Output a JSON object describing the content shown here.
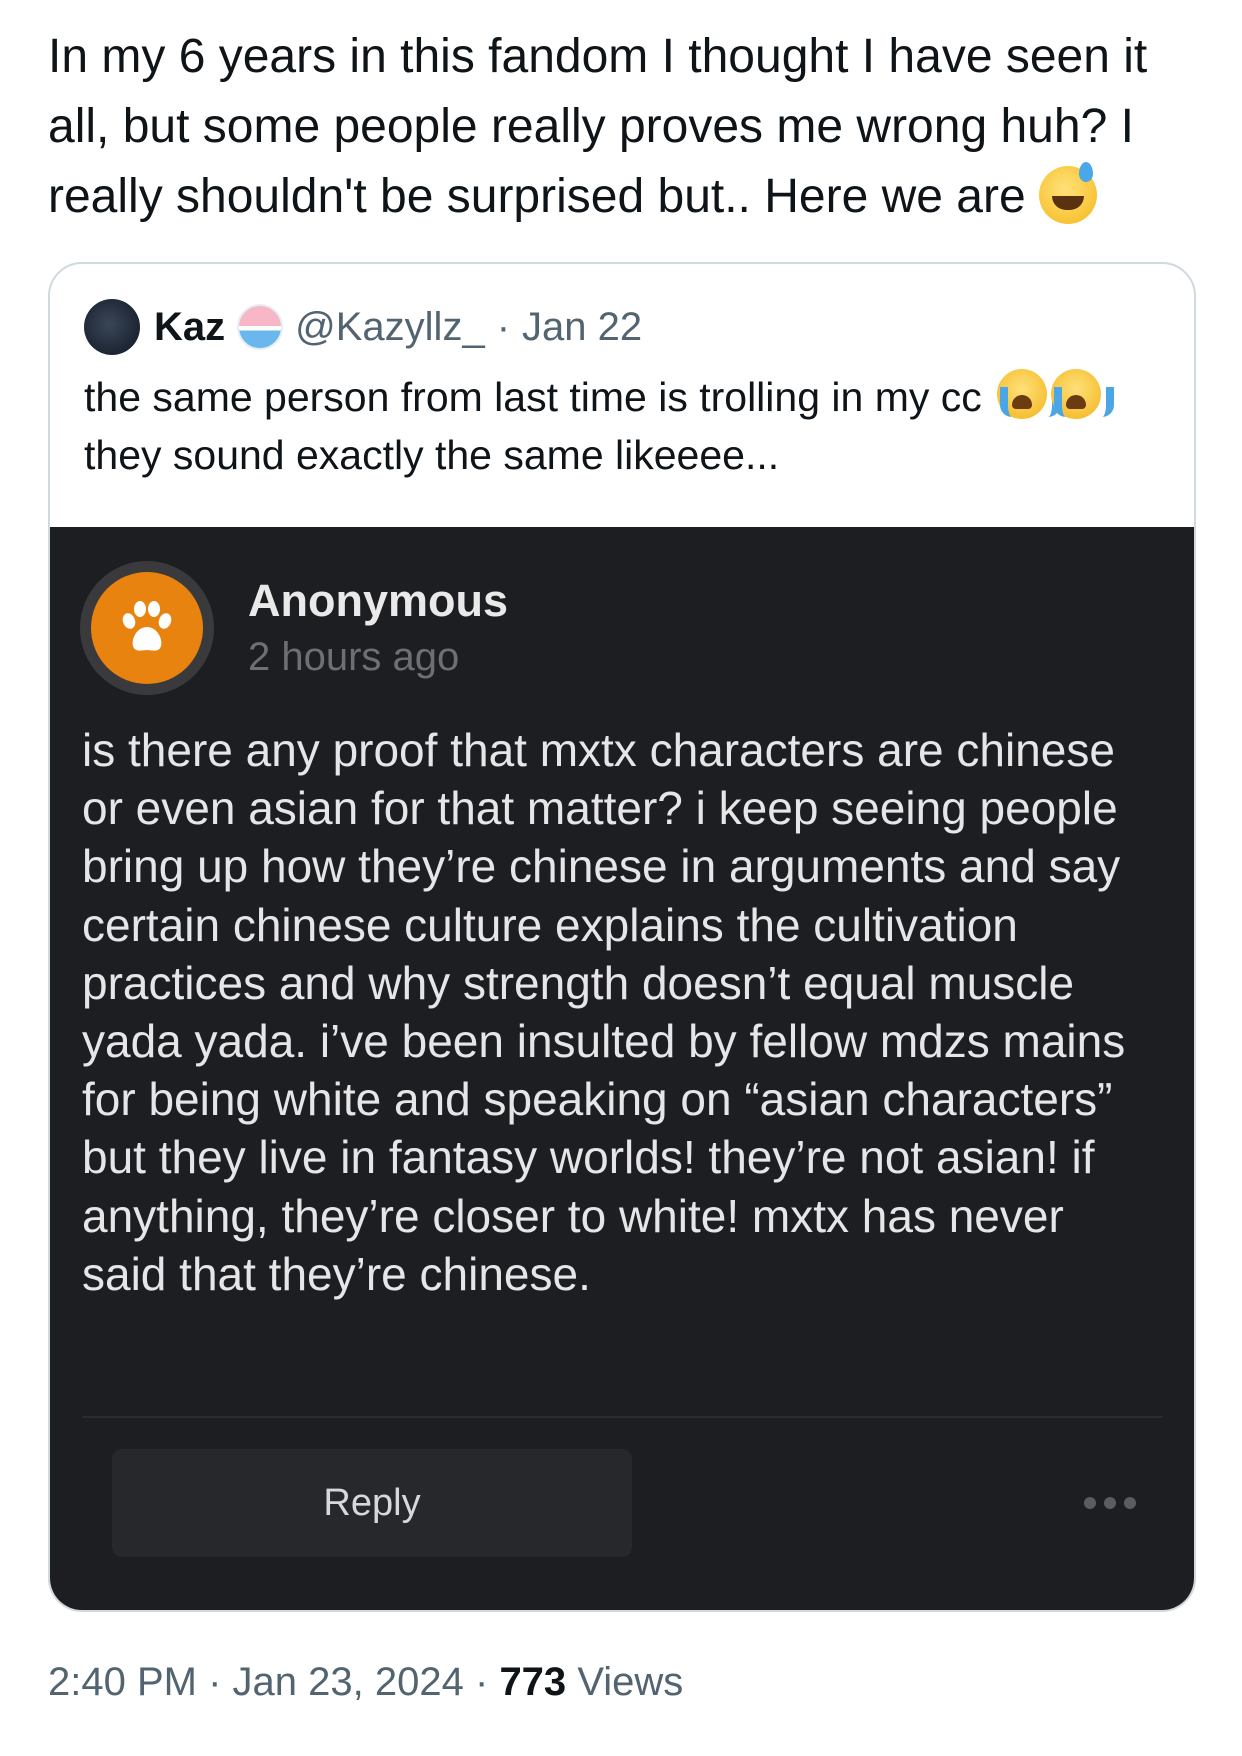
{
  "tweet": {
    "text": "In my 6 years in this fandom I thought I have seen it all, but some people really proves me wrong huh? I really shouldn't be surprised but.. Here we are",
    "emoji": "sweat-smile-emoji",
    "quoted": {
      "name": "Kaz",
      "name_emoji": "shaved-ice-emoji",
      "handle": "@Kazyllz_",
      "separator": "·",
      "date": "Jan 22",
      "text_line1": "the same person from last time is trolling in my cc",
      "text_line2": "they sound exactly the same likeeee...",
      "emoji": "loudly-crying-emoji",
      "image": {
        "author": "Anonymous",
        "time": "2 hours ago",
        "body": "is there any proof that mxtx characters are chinese or even asian for that matter? i keep seeing people bring up how they’re chinese in arguments and say certain chinese culture explains the cultivation practices and why strength doesn’t equal muscle yada yada. i’ve been insulted by fellow mdzs mains for being white and speaking on “asian characters” but they live in fantasy worlds! they’re not asian! if anything, they’re closer to white! mxtx has never said that they’re chinese.",
        "reply_label": "Reply",
        "avatar_icon": "paw-icon",
        "avatar_color": "#e8830f",
        "background": "#1d1e21"
      }
    }
  },
  "meta": {
    "time": "2:40 PM",
    "separator": "·",
    "date": "Jan 23, 2024",
    "views_count": "773",
    "views_label": "Views"
  }
}
